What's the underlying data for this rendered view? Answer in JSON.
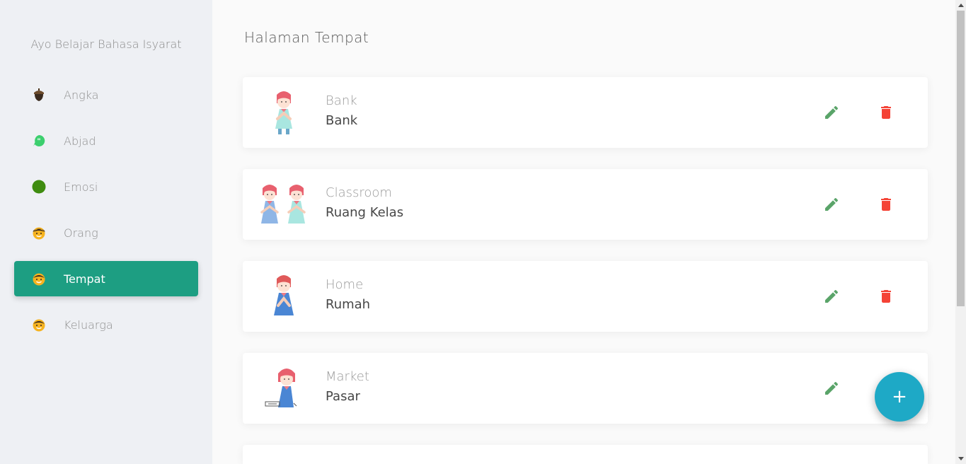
{
  "sidebar": {
    "brand": "Ayo Belajar Bahasa Isyarat",
    "items": [
      {
        "label": "Angka",
        "icon": "acorn-icon"
      },
      {
        "label": "Abjad",
        "icon": "quote-bubble-icon"
      },
      {
        "label": "Emosi",
        "icon": "green-circle-icon"
      },
      {
        "label": "Orang",
        "icon": "person-face-icon"
      },
      {
        "label": "Tempat",
        "icon": "person-face-icon"
      },
      {
        "label": "Keluarga",
        "icon": "person-face-icon"
      }
    ],
    "active": "Tempat"
  },
  "main": {
    "title": "Halaman Tempat",
    "cards": [
      {
        "english": "Bank",
        "indonesian": "Bank",
        "image": "sign-bank-illustration"
      },
      {
        "english": "Classroom",
        "indonesian": "Ruang Kelas",
        "image": "sign-classroom-illustration"
      },
      {
        "english": "Home",
        "indonesian": "Rumah",
        "image": "sign-home-illustration"
      },
      {
        "english": "Market",
        "indonesian": "Pasar",
        "image": "sign-market-illustration"
      }
    ],
    "fab_label": "+"
  },
  "colors": {
    "accent": "#1d9e82",
    "edit": "#5aa469",
    "delete": "#f44336",
    "fab": "#1ea9c6"
  }
}
